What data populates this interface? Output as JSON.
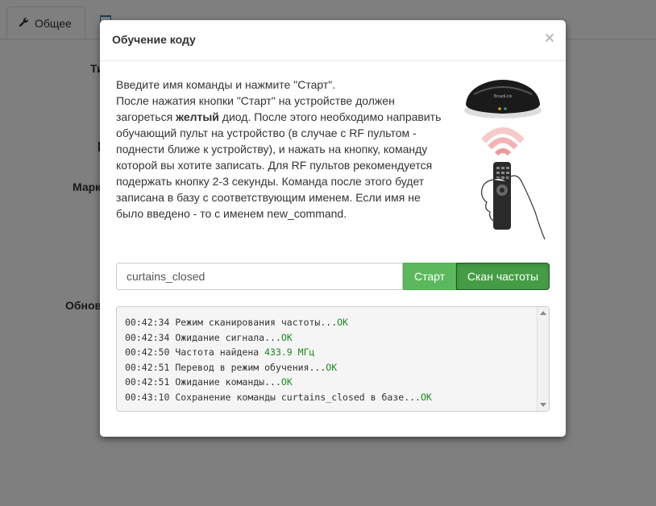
{
  "tabs": [
    {
      "label": "Общее",
      "icon": "wrench-icon"
    },
    {
      "label": "",
      "icon": "list-icon"
    }
  ],
  "background_labels": [
    "Ти",
    "Марк",
    "Обнов"
  ],
  "modal": {
    "title": "Обучение коду",
    "close_symbol": "×",
    "description": {
      "line1": "Введите имя команды и нажмите \"Старт\".",
      "part1": "После нажатия кнопки \"Старт\" на устройстве должен загореться ",
      "bold": "желтый",
      "part2": " диод. После этого необходимо направить обучающий пульт на устройство (в случае с RF пультом - поднести ближе к устройству), и нажать на кнопку, команду которой вы хотите записать. Для RF пультов рекомендуется подержать кнопку 2-3 секунды. Команда после этого будет записана в базу с соответствующим именем. Если имя не было введено - то с именем new_command."
    },
    "device_brand": "BroadLink",
    "command_input": {
      "value": "curtains_closed"
    },
    "start_button": "Старт",
    "scan_button": "Скан частоты",
    "log": [
      {
        "time": "00:42:34",
        "text": "Режим сканирования частоты...",
        "status": "OK",
        "value": ""
      },
      {
        "time": "00:42:34",
        "text": "Ожидание сигнала...",
        "status": "OK",
        "value": ""
      },
      {
        "time": "00:42:50",
        "text": "Частота найдена ",
        "status": "",
        "value": "433.9 МГц"
      },
      {
        "time": "00:42:51",
        "text": "Перевод в режим обучения...",
        "status": "OK",
        "value": ""
      },
      {
        "time": "00:42:51",
        "text": "Ожидание команды...",
        "status": "OK",
        "value": ""
      },
      {
        "time": "00:43:10",
        "text": "Сохранение команды curtains_closed в базе...",
        "status": "OK",
        "value": ""
      }
    ]
  },
  "colors": {
    "success": "#5cb85c",
    "success_active": "#449d44",
    "ok_text": "#1a8a1a"
  }
}
